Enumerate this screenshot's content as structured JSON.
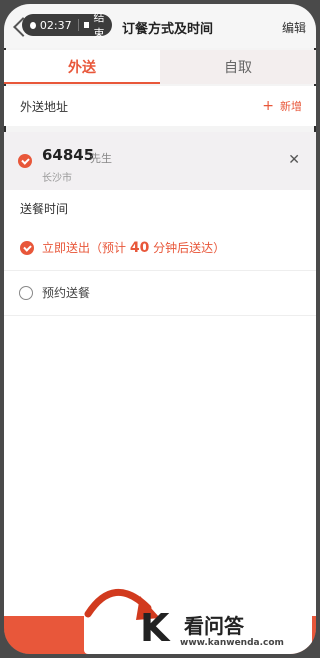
{
  "status": {
    "time": "02:37",
    "stop_label": "结束"
  },
  "header": {
    "title": "订餐方式及时间",
    "edit_label": "编辑"
  },
  "tabs": [
    {
      "label": "外送",
      "active": true
    },
    {
      "label": "自取",
      "active": false
    }
  ],
  "address_section": {
    "title": "外送地址",
    "add_label": "新增",
    "address": {
      "number": "64845",
      "title": "先生",
      "city": "长沙市"
    }
  },
  "delivery_section": {
    "title": "送餐时间",
    "options": [
      {
        "prefix": "立即送出（预计 ",
        "minutes": "40",
        "suffix": " 分钟后送达）",
        "selected": true
      },
      {
        "label": "预约送餐",
        "selected": false
      }
    ]
  },
  "watermark": {
    "brand": "看问答",
    "url": "www.kanwenda.com"
  },
  "colors": {
    "accent": "#e8573a"
  }
}
